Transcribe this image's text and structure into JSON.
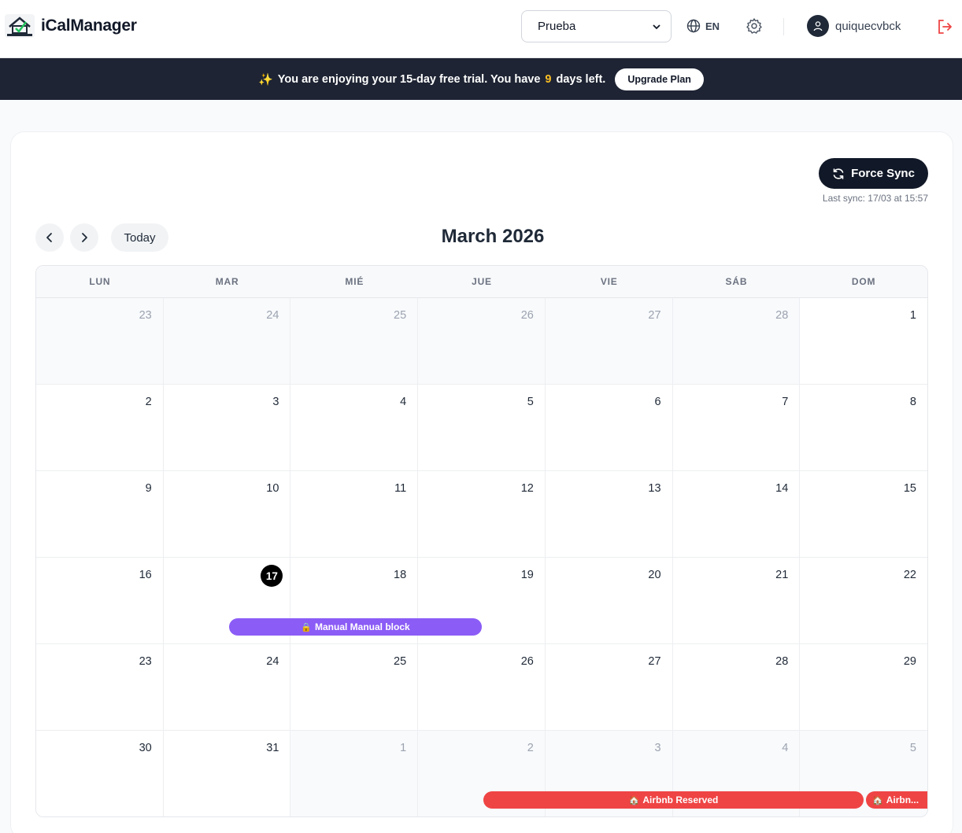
{
  "header": {
    "app_title": "iCalManager",
    "property_selected": "Prueba",
    "language": "EN",
    "username": "quiquecvbck"
  },
  "banner": {
    "text_before": "You are enjoying your 15-day free trial. You have",
    "days_left": "9",
    "text_after": "days left.",
    "upgrade_label": "Upgrade Plan"
  },
  "toolbar": {
    "sync_label": "Force Sync",
    "last_sync": "Last sync: 17/03 at 15:57",
    "today_label": "Today",
    "month_title": "March 2026"
  },
  "calendar": {
    "weekdays": [
      "LUN",
      "MAR",
      "MIÉ",
      "JUE",
      "VIE",
      "SÁB",
      "DOM"
    ],
    "days": [
      {
        "n": "23",
        "other": true
      },
      {
        "n": "24",
        "other": true
      },
      {
        "n": "25",
        "other": true
      },
      {
        "n": "26",
        "other": true
      },
      {
        "n": "27",
        "other": true
      },
      {
        "n": "28",
        "other": true
      },
      {
        "n": "1",
        "other": false
      },
      {
        "n": "2",
        "other": false
      },
      {
        "n": "3",
        "other": false
      },
      {
        "n": "4",
        "other": false
      },
      {
        "n": "5",
        "other": false
      },
      {
        "n": "6",
        "other": false
      },
      {
        "n": "7",
        "other": false
      },
      {
        "n": "8",
        "other": false
      },
      {
        "n": "9",
        "other": false
      },
      {
        "n": "10",
        "other": false
      },
      {
        "n": "11",
        "other": false
      },
      {
        "n": "12",
        "other": false
      },
      {
        "n": "13",
        "other": false
      },
      {
        "n": "14",
        "other": false
      },
      {
        "n": "15",
        "other": false
      },
      {
        "n": "16",
        "other": false
      },
      {
        "n": "17",
        "other": false,
        "today": true
      },
      {
        "n": "18",
        "other": false
      },
      {
        "n": "19",
        "other": false
      },
      {
        "n": "20",
        "other": false
      },
      {
        "n": "21",
        "other": false
      },
      {
        "n": "22",
        "other": false
      },
      {
        "n": "23",
        "other": false
      },
      {
        "n": "24",
        "other": false
      },
      {
        "n": "25",
        "other": false
      },
      {
        "n": "26",
        "other": false
      },
      {
        "n": "27",
        "other": false
      },
      {
        "n": "28",
        "other": false
      },
      {
        "n": "29",
        "other": false
      },
      {
        "n": "30",
        "other": false
      },
      {
        "n": "31",
        "other": false
      },
      {
        "n": "1",
        "other": true
      },
      {
        "n": "2",
        "other": true
      },
      {
        "n": "3",
        "other": true
      },
      {
        "n": "4",
        "other": true
      },
      {
        "n": "5",
        "other": true
      }
    ],
    "events": {
      "manual": "Manual Manual block",
      "airbnb": "Airbnb Reserved",
      "airbnb_truncated": "Airbn..."
    }
  },
  "colors": {
    "manual": "#8b5cf6",
    "airbnb": "#ef4444",
    "banner_bg": "#1e2433",
    "today": "#000000"
  }
}
